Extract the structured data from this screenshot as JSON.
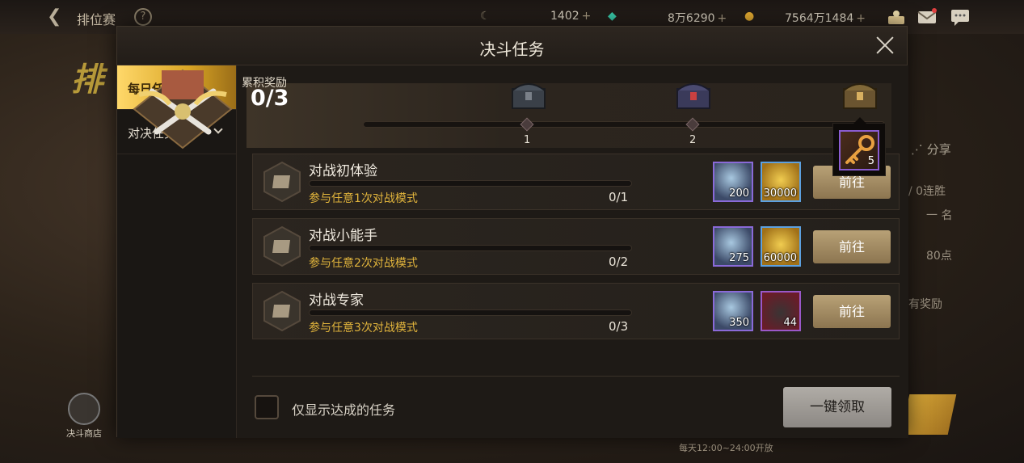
{
  "topbar": {
    "title": "排位赛",
    "help_icon": "question-icon",
    "currency_1": "1402",
    "currency_2": "8万6290",
    "currency_3": "7564万1484",
    "plus": "+"
  },
  "background": {
    "share_label": "分享",
    "shop_label": "决斗商店",
    "bottom_note": "每天12:00~24:00开放",
    "side_texts": [
      "/ 0连胜",
      "一 名",
      "80点",
      "有奖励"
    ]
  },
  "dialog": {
    "title": "决斗任务"
  },
  "sidenav": {
    "items": [
      {
        "label": "每日任务",
        "active": true
      },
      {
        "label": "对决任务",
        "active": false
      }
    ]
  },
  "rewards": {
    "label": "累积奖励",
    "value": "0/3",
    "progress": 0,
    "markers": [
      "1",
      "2"
    ],
    "tooltip_count": "5"
  },
  "tasks": [
    {
      "name": "对战初体验",
      "desc": "参与任意1次对战模式",
      "progress": "0/1",
      "reward1": "200",
      "reward2": "30000",
      "button": "前往"
    },
    {
      "name": "对战小能手",
      "desc": "参与任意2次对战模式",
      "progress": "0/2",
      "reward1": "275",
      "reward2": "60000",
      "button": "前往"
    },
    {
      "name": "对战专家",
      "desc": "参与任意3次对战模式",
      "progress": "0/3",
      "reward1": "350",
      "reward2": "44",
      "button": "前往"
    }
  ],
  "footer": {
    "checkbox_label": "仅显示达成的任务",
    "checked": false,
    "claim_all": "一键领取"
  },
  "colors": {
    "accent_gold": "#e2b53c",
    "nav_active": "#d9a525",
    "button_gold": "#a58c62",
    "button_disabled": "#9e9a95"
  }
}
